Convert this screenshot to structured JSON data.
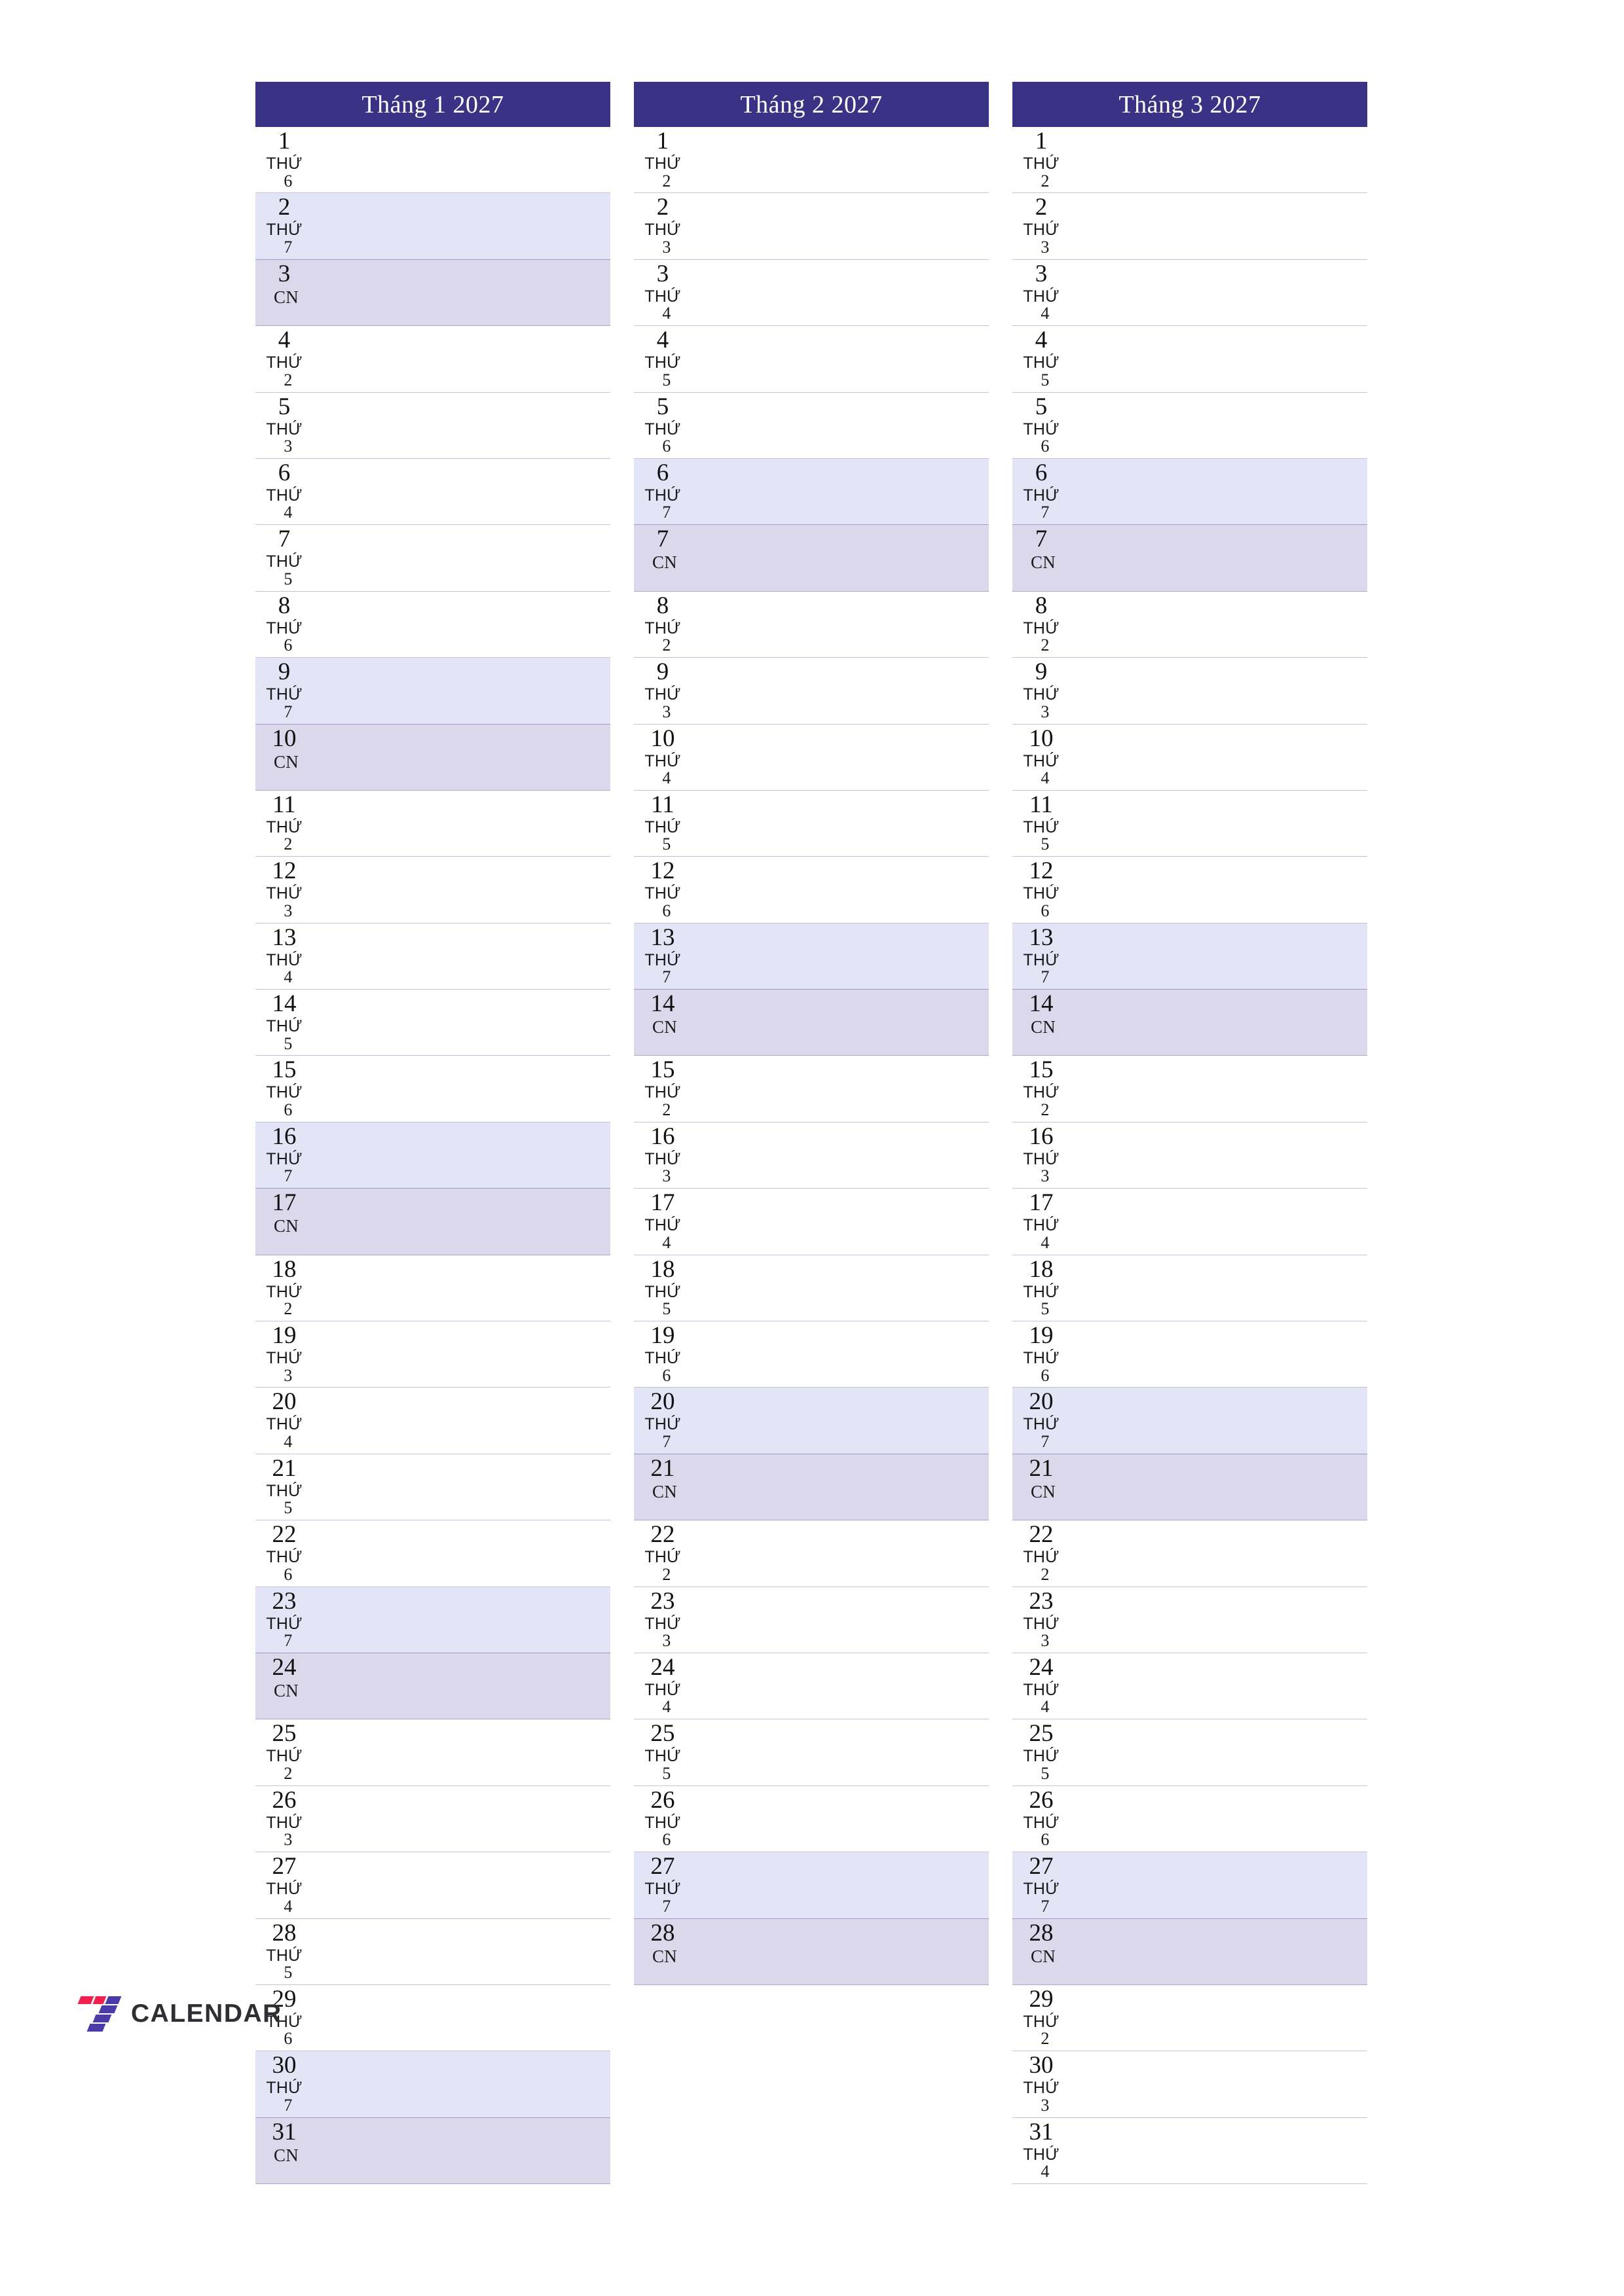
{
  "meta": {
    "year": "2027",
    "weekday_word": "THỨ",
    "sunday_label": "CN"
  },
  "colors": {
    "header_bg": "#3a3285",
    "header_text": "#ffffff",
    "saturday_bg": "#e3e4f6",
    "sunday_bg": "#dad8ea",
    "rule": "#b9b7d4",
    "logo_red": "#f3204f",
    "logo_purple": "#4a3ba8",
    "logo_text": "#2e2e33"
  },
  "brand": {
    "name": "CALENDAR",
    "mark": "seven-logo-icon"
  },
  "months": [
    {
      "title": "Tháng 1 2027",
      "days": [
        {
          "n": "1",
          "dow": "THỨ",
          "dnum": "6",
          "type": "weekday"
        },
        {
          "n": "2",
          "dow": "THỨ",
          "dnum": "7",
          "type": "sat"
        },
        {
          "n": "3",
          "dow": "CN",
          "dnum": "",
          "type": "sun"
        },
        {
          "n": "4",
          "dow": "THỨ",
          "dnum": "2",
          "type": "weekday"
        },
        {
          "n": "5",
          "dow": "THỨ",
          "dnum": "3",
          "type": "weekday"
        },
        {
          "n": "6",
          "dow": "THỨ",
          "dnum": "4",
          "type": "weekday"
        },
        {
          "n": "7",
          "dow": "THỨ",
          "dnum": "5",
          "type": "weekday"
        },
        {
          "n": "8",
          "dow": "THỨ",
          "dnum": "6",
          "type": "weekday"
        },
        {
          "n": "9",
          "dow": "THỨ",
          "dnum": "7",
          "type": "sat"
        },
        {
          "n": "10",
          "dow": "CN",
          "dnum": "",
          "type": "sun"
        },
        {
          "n": "11",
          "dow": "THỨ",
          "dnum": "2",
          "type": "weekday"
        },
        {
          "n": "12",
          "dow": "THỨ",
          "dnum": "3",
          "type": "weekday"
        },
        {
          "n": "13",
          "dow": "THỨ",
          "dnum": "4",
          "type": "weekday"
        },
        {
          "n": "14",
          "dow": "THỨ",
          "dnum": "5",
          "type": "weekday"
        },
        {
          "n": "15",
          "dow": "THỨ",
          "dnum": "6",
          "type": "weekday"
        },
        {
          "n": "16",
          "dow": "THỨ",
          "dnum": "7",
          "type": "sat"
        },
        {
          "n": "17",
          "dow": "CN",
          "dnum": "",
          "type": "sun"
        },
        {
          "n": "18",
          "dow": "THỨ",
          "dnum": "2",
          "type": "weekday"
        },
        {
          "n": "19",
          "dow": "THỨ",
          "dnum": "3",
          "type": "weekday"
        },
        {
          "n": "20",
          "dow": "THỨ",
          "dnum": "4",
          "type": "weekday"
        },
        {
          "n": "21",
          "dow": "THỨ",
          "dnum": "5",
          "type": "weekday"
        },
        {
          "n": "22",
          "dow": "THỨ",
          "dnum": "6",
          "type": "weekday"
        },
        {
          "n": "23",
          "dow": "THỨ",
          "dnum": "7",
          "type": "sat"
        },
        {
          "n": "24",
          "dow": "CN",
          "dnum": "",
          "type": "sun"
        },
        {
          "n": "25",
          "dow": "THỨ",
          "dnum": "2",
          "type": "weekday"
        },
        {
          "n": "26",
          "dow": "THỨ",
          "dnum": "3",
          "type": "weekday"
        },
        {
          "n": "27",
          "dow": "THỨ",
          "dnum": "4",
          "type": "weekday"
        },
        {
          "n": "28",
          "dow": "THỨ",
          "dnum": "5",
          "type": "weekday"
        },
        {
          "n": "29",
          "dow": "THỨ",
          "dnum": "6",
          "type": "weekday"
        },
        {
          "n": "30",
          "dow": "THỨ",
          "dnum": "7",
          "type": "sat"
        },
        {
          "n": "31",
          "dow": "CN",
          "dnum": "",
          "type": "sun"
        }
      ]
    },
    {
      "title": "Tháng 2 2027",
      "days": [
        {
          "n": "1",
          "dow": "THỨ",
          "dnum": "2",
          "type": "weekday"
        },
        {
          "n": "2",
          "dow": "THỨ",
          "dnum": "3",
          "type": "weekday"
        },
        {
          "n": "3",
          "dow": "THỨ",
          "dnum": "4",
          "type": "weekday"
        },
        {
          "n": "4",
          "dow": "THỨ",
          "dnum": "5",
          "type": "weekday"
        },
        {
          "n": "5",
          "dow": "THỨ",
          "dnum": "6",
          "type": "weekday"
        },
        {
          "n": "6",
          "dow": "THỨ",
          "dnum": "7",
          "type": "sat"
        },
        {
          "n": "7",
          "dow": "CN",
          "dnum": "",
          "type": "sun"
        },
        {
          "n": "8",
          "dow": "THỨ",
          "dnum": "2",
          "type": "weekday"
        },
        {
          "n": "9",
          "dow": "THỨ",
          "dnum": "3",
          "type": "weekday"
        },
        {
          "n": "10",
          "dow": "THỨ",
          "dnum": "4",
          "type": "weekday"
        },
        {
          "n": "11",
          "dow": "THỨ",
          "dnum": "5",
          "type": "weekday"
        },
        {
          "n": "12",
          "dow": "THỨ",
          "dnum": "6",
          "type": "weekday"
        },
        {
          "n": "13",
          "dow": "THỨ",
          "dnum": "7",
          "type": "sat"
        },
        {
          "n": "14",
          "dow": "CN",
          "dnum": "",
          "type": "sun"
        },
        {
          "n": "15",
          "dow": "THỨ",
          "dnum": "2",
          "type": "weekday"
        },
        {
          "n": "16",
          "dow": "THỨ",
          "dnum": "3",
          "type": "weekday"
        },
        {
          "n": "17",
          "dow": "THỨ",
          "dnum": "4",
          "type": "weekday"
        },
        {
          "n": "18",
          "dow": "THỨ",
          "dnum": "5",
          "type": "weekday"
        },
        {
          "n": "19",
          "dow": "THỨ",
          "dnum": "6",
          "type": "weekday"
        },
        {
          "n": "20",
          "dow": "THỨ",
          "dnum": "7",
          "type": "sat"
        },
        {
          "n": "21",
          "dow": "CN",
          "dnum": "",
          "type": "sun"
        },
        {
          "n": "22",
          "dow": "THỨ",
          "dnum": "2",
          "type": "weekday"
        },
        {
          "n": "23",
          "dow": "THỨ",
          "dnum": "3",
          "type": "weekday"
        },
        {
          "n": "24",
          "dow": "THỨ",
          "dnum": "4",
          "type": "weekday"
        },
        {
          "n": "25",
          "dow": "THỨ",
          "dnum": "5",
          "type": "weekday"
        },
        {
          "n": "26",
          "dow": "THỨ",
          "dnum": "6",
          "type": "weekday"
        },
        {
          "n": "27",
          "dow": "THỨ",
          "dnum": "7",
          "type": "sat"
        },
        {
          "n": "28",
          "dow": "CN",
          "dnum": "",
          "type": "sun"
        }
      ]
    },
    {
      "title": "Tháng 3 2027",
      "days": [
        {
          "n": "1",
          "dow": "THỨ",
          "dnum": "2",
          "type": "weekday"
        },
        {
          "n": "2",
          "dow": "THỨ",
          "dnum": "3",
          "type": "weekday"
        },
        {
          "n": "3",
          "dow": "THỨ",
          "dnum": "4",
          "type": "weekday"
        },
        {
          "n": "4",
          "dow": "THỨ",
          "dnum": "5",
          "type": "weekday"
        },
        {
          "n": "5",
          "dow": "THỨ",
          "dnum": "6",
          "type": "weekday"
        },
        {
          "n": "6",
          "dow": "THỨ",
          "dnum": "7",
          "type": "sat"
        },
        {
          "n": "7",
          "dow": "CN",
          "dnum": "",
          "type": "sun"
        },
        {
          "n": "8",
          "dow": "THỨ",
          "dnum": "2",
          "type": "weekday"
        },
        {
          "n": "9",
          "dow": "THỨ",
          "dnum": "3",
          "type": "weekday"
        },
        {
          "n": "10",
          "dow": "THỨ",
          "dnum": "4",
          "type": "weekday"
        },
        {
          "n": "11",
          "dow": "THỨ",
          "dnum": "5",
          "type": "weekday"
        },
        {
          "n": "12",
          "dow": "THỨ",
          "dnum": "6",
          "type": "weekday"
        },
        {
          "n": "13",
          "dow": "THỨ",
          "dnum": "7",
          "type": "sat"
        },
        {
          "n": "14",
          "dow": "CN",
          "dnum": "",
          "type": "sun"
        },
        {
          "n": "15",
          "dow": "THỨ",
          "dnum": "2",
          "type": "weekday"
        },
        {
          "n": "16",
          "dow": "THỨ",
          "dnum": "3",
          "type": "weekday"
        },
        {
          "n": "17",
          "dow": "THỨ",
          "dnum": "4",
          "type": "weekday"
        },
        {
          "n": "18",
          "dow": "THỨ",
          "dnum": "5",
          "type": "weekday"
        },
        {
          "n": "19",
          "dow": "THỨ",
          "dnum": "6",
          "type": "weekday"
        },
        {
          "n": "20",
          "dow": "THỨ",
          "dnum": "7",
          "type": "sat"
        },
        {
          "n": "21",
          "dow": "CN",
          "dnum": "",
          "type": "sun"
        },
        {
          "n": "22",
          "dow": "THỨ",
          "dnum": "2",
          "type": "weekday"
        },
        {
          "n": "23",
          "dow": "THỨ",
          "dnum": "3",
          "type": "weekday"
        },
        {
          "n": "24",
          "dow": "THỨ",
          "dnum": "4",
          "type": "weekday"
        },
        {
          "n": "25",
          "dow": "THỨ",
          "dnum": "5",
          "type": "weekday"
        },
        {
          "n": "26",
          "dow": "THỨ",
          "dnum": "6",
          "type": "weekday"
        },
        {
          "n": "27",
          "dow": "THỨ",
          "dnum": "7",
          "type": "sat"
        },
        {
          "n": "28",
          "dow": "CN",
          "dnum": "",
          "type": "sun"
        },
        {
          "n": "29",
          "dow": "THỨ",
          "dnum": "2",
          "type": "weekday"
        },
        {
          "n": "30",
          "dow": "THỨ",
          "dnum": "3",
          "type": "weekday"
        },
        {
          "n": "31",
          "dow": "THỨ",
          "dnum": "4",
          "type": "weekday"
        }
      ]
    }
  ]
}
